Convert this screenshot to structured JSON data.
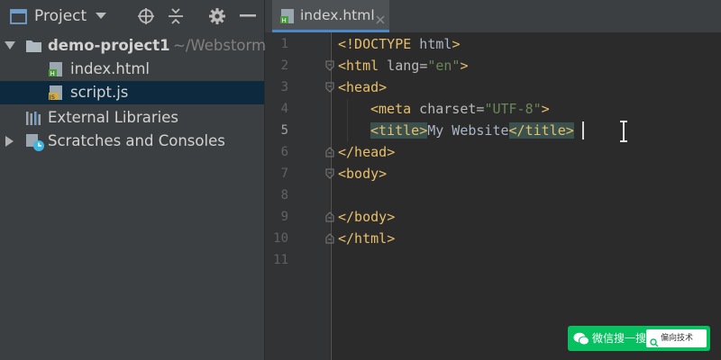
{
  "project_panel": {
    "title": "Project",
    "tree": [
      {
        "label": "demo-project1",
        "hint": "~/Webstorm",
        "expanded": true,
        "icon": "folder-icon"
      },
      {
        "label": "index.html",
        "icon": "html-file-icon"
      },
      {
        "label": "script.js",
        "icon": "js-file-icon",
        "selected": true
      },
      {
        "label": "External Libraries",
        "icon": "libraries-icon"
      },
      {
        "label": "Scratches and Consoles",
        "icon": "scratches-icon",
        "expanded": false
      }
    ]
  },
  "editor": {
    "tab": {
      "label": "index.html",
      "icon": "html-file-icon"
    },
    "current_line": 5,
    "lines": [
      {
        "n": "1",
        "text": "<!DOCTYPE html>"
      },
      {
        "n": "2",
        "text": "<html lang=\"en\">"
      },
      {
        "n": "3",
        "text": "<head>"
      },
      {
        "n": "4",
        "text": "<meta charset=\"UTF-8\">"
      },
      {
        "n": "5",
        "text": "<title>My Website</title>"
      },
      {
        "n": "6",
        "text": "</head>"
      },
      {
        "n": "7",
        "text": "<body>"
      },
      {
        "n": "8",
        "text": ""
      },
      {
        "n": "9",
        "text": "</body>"
      },
      {
        "n": "10",
        "text": "</html>"
      },
      {
        "n": "11",
        "text": ""
      }
    ]
  },
  "watermark": {
    "text": "微信搜一搜",
    "search_text": "偏向技术"
  },
  "colors": {
    "panel_bg": "#3c3f41",
    "editor_bg": "#2b2b2b",
    "gutter_bg": "#313335",
    "selection": "#0d293e",
    "tag": "#e8bf6a",
    "string": "#6a8759",
    "attribute": "#bababa",
    "tab_accent": "#4a88c7",
    "wechat_green": "#07c160"
  }
}
